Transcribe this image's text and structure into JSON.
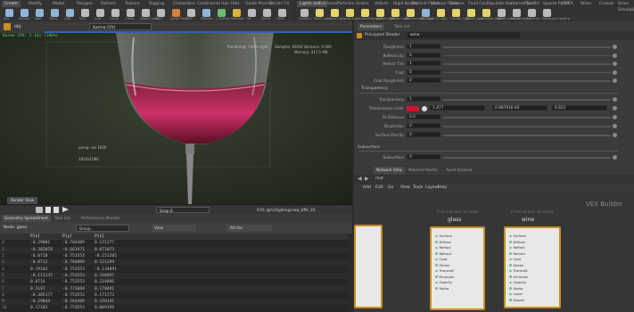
{
  "shelf_left": {
    "tabs": [
      "Create",
      "Modify",
      "Model",
      "Polygon",
      "Deform",
      "Texture",
      "Rigging",
      "Characters",
      "Constraints",
      "Hair Utils",
      "Guide Process",
      "Terrain FX"
    ],
    "tools": [
      {
        "label": "Box",
        "color": "#8fb6d8"
      },
      {
        "label": "Sphere",
        "color": "#8fb6d8"
      },
      {
        "label": "Tube",
        "color": "#8fb6d8"
      },
      {
        "label": "Torus",
        "color": "#8fb6d8"
      },
      {
        "label": "Grid",
        "color": "#8fb6d8"
      },
      {
        "label": "Null",
        "color": "#bbbbbb"
      },
      {
        "label": "Line",
        "color": "#bbbbbb"
      },
      {
        "label": "Circle",
        "color": "#bbbbbb"
      },
      {
        "label": "Curve",
        "color": "#bbbbbb"
      },
      {
        "label": "Draw Curve",
        "color": "#bbbbbb"
      },
      {
        "label": "Path",
        "color": "#bbbbbb"
      },
      {
        "label": "Spray Paint",
        "color": "#d97f3c"
      },
      {
        "label": "Font",
        "color": "#bbbbbb"
      },
      {
        "label": "Platonic",
        "color": "#8fb6d8"
      },
      {
        "label": "L-System",
        "color": "#6bbf6b"
      },
      {
        "label": "Metaball",
        "color": "#d9b441"
      },
      {
        "label": "File",
        "color": "#bbbbbb"
      },
      {
        "label": "Spiral",
        "color": "#bbbbbb"
      },
      {
        "label": "Helix",
        "color": "#bbbbbb"
      }
    ]
  },
  "shelf_right": {
    "tabs": [
      "Lights and...",
      "Collisions",
      "Particles",
      "Grains",
      "Vellum",
      "Rigid Bodies",
      "Particle Fluids",
      "Viscous Fluids",
      "Oceans",
      "Fluid Con...",
      "Populate Con...",
      "Container Tools",
      "Pyro FX",
      "Sparse Pyro FX",
      "FEM",
      "Wires",
      "Crowds",
      "Drive Simulation"
    ],
    "tools": [
      {
        "label": "Camera",
        "color": "#bbbbbb"
      },
      {
        "label": "Point Light",
        "color": "#e6d36a"
      },
      {
        "label": "Spot Light",
        "color": "#e6d36a"
      },
      {
        "label": "Area Light",
        "color": "#e6d36a"
      },
      {
        "label": "Geometry Light",
        "color": "#e6d36a"
      },
      {
        "label": "Volume Light",
        "color": "#e6d36a"
      },
      {
        "label": "Distant Light",
        "color": "#e6d36a"
      },
      {
        "label": "Environment Light",
        "color": "#e6d36a"
      },
      {
        "label": "Sky Light",
        "color": "#8fb6d8"
      },
      {
        "label": "GI Light",
        "color": "#e6d36a"
      },
      {
        "label": "Caustic Light",
        "color": "#e6d36a"
      },
      {
        "label": "Portal Light",
        "color": "#e6d36a"
      },
      {
        "label": "Ambient Light",
        "color": "#e6d36a"
      },
      {
        "label": "Stereo Camera",
        "color": "#bbbbbb"
      },
      {
        "label": "VR Camera",
        "color": "#bbbbbb"
      },
      {
        "label": "Switcher",
        "color": "#bbbbbb"
      },
      {
        "label": "Gamepad Camera",
        "color": "#bbbbbb"
      }
    ]
  },
  "viewport": {
    "tab": "Scene View",
    "path": "obj",
    "camera": "Karma CPU",
    "overlay_tl": "Karma CPU: 2.14s (100%)",
    "overlay_tr1": "Rendering: 100% Light...",
    "overlay_tr2": "Samples: 64/64   Variance: 0.000",
    "overlay_tr3": "Memory: 417.5 MB",
    "overlay_bl1": "persp: res 1920",
    "overlay_bl2": "1920x1080",
    "snapshot_label": "Snap 0",
    "status": "0:01  /gm1/lighting/view_DRV_1D",
    "bottom_tab": "Render View"
  },
  "spreadsheet": {
    "tabs": [
      "Geometry Spreadsheet",
      "Take List",
      "Performance Monitor"
    ],
    "path": "obj",
    "node": "Node: glass",
    "filter": "Group",
    "view": "View",
    "attrib_filter": "Attribs",
    "columns": [
      "",
      "P[x]",
      "P[y]",
      "P[z]"
    ],
    "rows": [
      [
        "0",
        "-0.29001",
        "-0.764409",
        "0.121277"
      ],
      [
        "1",
        "-0.302078",
        "-0.661971",
        "0.071073"
      ],
      [
        "2",
        "-0.0718",
        "-0.753553",
        "-0.151205"
      ],
      [
        "3",
        "-0.0712",
        "-0.764069",
        "0.121299"
      ],
      [
        "4",
        "0.19183",
        "-0.753553",
        "-0.134091"
      ],
      [
        "5",
        "-0.111137",
        "-0.753553",
        "0.196097"
      ],
      [
        "6",
        "0.0714",
        "-0.753553",
        "0.219096"
      ],
      [
        "7",
        "0.1197",
        "-0.771069",
        "0.170491"
      ],
      [
        "8",
        "-0.305177",
        "-0.753553",
        "0.171773"
      ],
      [
        "9",
        "-0.29044",
        "-0.764409",
        "0.158191"
      ],
      [
        "10",
        "0.17181",
        "-0.753553",
        "0.009199"
      ]
    ]
  },
  "params": {
    "tabs": [
      "Parameters",
      "Take List"
    ],
    "node_type": "Principled Shader",
    "node_name": "wine",
    "rows": [
      {
        "label": "Roughness",
        "value": "1"
      },
      {
        "label": "Reflectivity",
        "value": "0"
      },
      {
        "label": "Reflect Tint",
        "value": "1"
      },
      {
        "label": "Coat",
        "value": "0"
      },
      {
        "label": "Coat Roughness",
        "value": "0"
      }
    ],
    "section": "Transparency",
    "rows2": [
      {
        "label": "Transparency",
        "value": "1"
      },
      {
        "label": "Transmission Color",
        "value": "1.477",
        "v2": "0.987916-40",
        "v3": "0.822",
        "swatch": "#c41a30"
      },
      {
        "label": "At Distance",
        "value": "0.2"
      },
      {
        "label": "Dispersion",
        "value": "0"
      },
      {
        "label": "Surface Priority",
        "value": "0"
      }
    ],
    "section2": "Subsurface",
    "rows3": [
      {
        "label": "Subsurface",
        "value": "0"
      }
    ]
  },
  "network": {
    "tabs": [
      "Network View",
      "Material Palette",
      "Asset Browser"
    ],
    "path": "mat",
    "menu": [
      "Add",
      "Edit",
      "Go",
      "View",
      "Tools",
      "Layout",
      "Help"
    ],
    "context_label": "VEX Builder",
    "nodes": [
      {
        "title": "",
        "subtitle": "",
        "name": "",
        "ports": []
      },
      {
        "title": "glass",
        "subtitle": "Principled Shader",
        "name": "glass",
        "ports": [
          "Surface",
          "Diffuse",
          "Reflect",
          "Refract",
          "Coat",
          "Sheen",
          "Transmit",
          "Emission",
          "Opacity",
          "Alpha"
        ]
      },
      {
        "title": "wine",
        "subtitle": "Principled Shader",
        "name": "wine",
        "ports": [
          "Surface",
          "Diffuse",
          "Reflect",
          "Refract",
          "Coat",
          "Sheen",
          "Transmit",
          "Emission",
          "Opacity",
          "Alpha",
          "Layer",
          "Export"
        ]
      }
    ]
  }
}
